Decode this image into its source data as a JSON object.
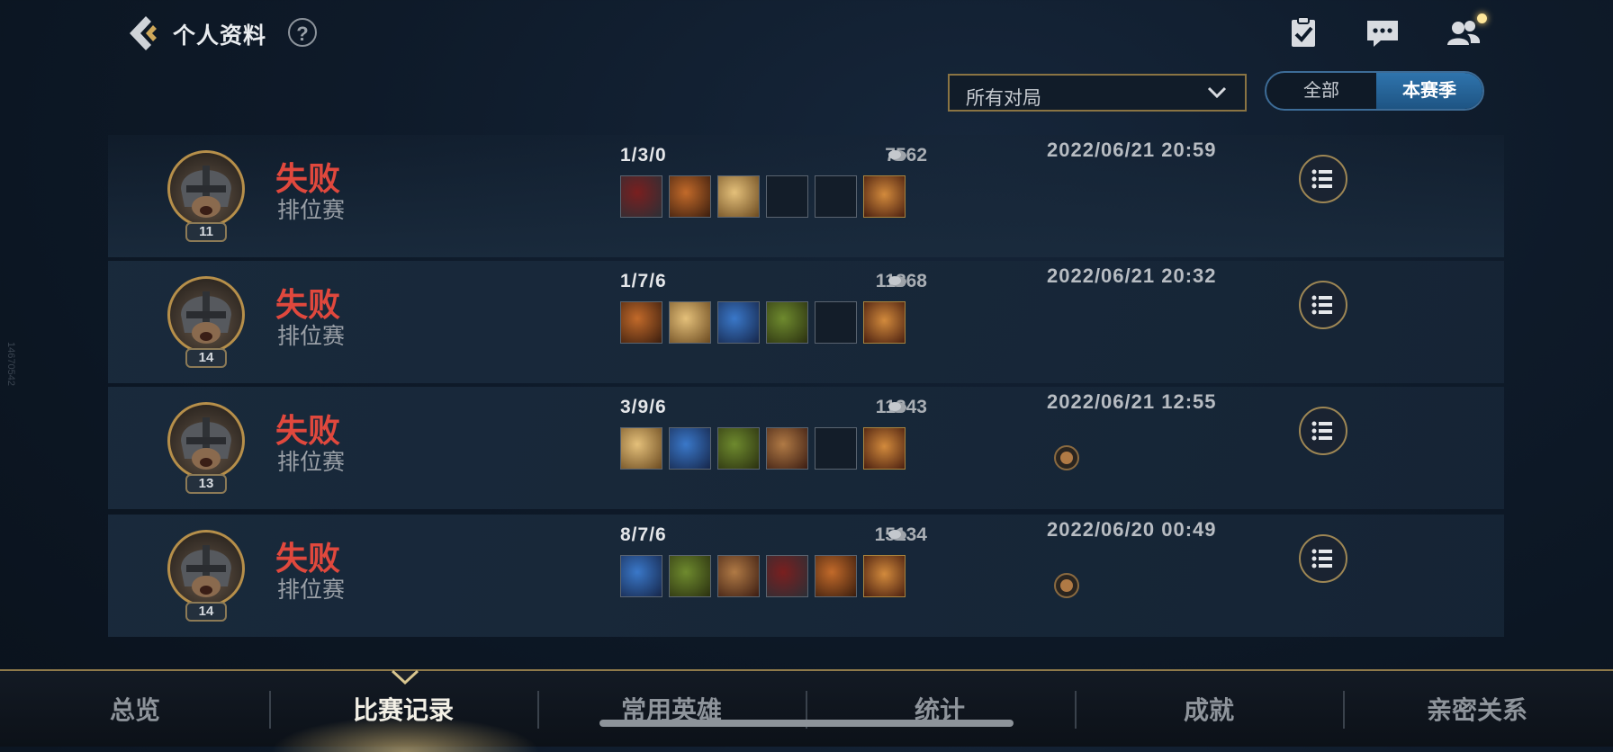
{
  "header": {
    "title": "个人资料",
    "help": "?"
  },
  "filter": {
    "selected": "所有对局",
    "season_all": "全部",
    "season_current": "本赛季"
  },
  "matches": [
    {
      "result": "失败",
      "mode": "排位赛",
      "level": "11",
      "kda": "1/3/0",
      "gold": "7562",
      "datetime": "2022/06/21 20:59",
      "items": [
        "item-icon",
        "item-icon",
        "item-icon",
        "empty",
        "empty",
        "trinket-icon"
      ],
      "badge": false
    },
    {
      "result": "失败",
      "mode": "排位赛",
      "level": "14",
      "kda": "1/7/6",
      "gold": "11868",
      "datetime": "2022/06/21 20:32",
      "items": [
        "item-icon",
        "item-icon",
        "item-icon",
        "item-icon",
        "empty",
        "trinket-icon"
      ],
      "badge": false
    },
    {
      "result": "失败",
      "mode": "排位赛",
      "level": "13",
      "kda": "3/9/6",
      "gold": "11343",
      "datetime": "2022/06/21 12:55",
      "items": [
        "item-icon",
        "item-icon",
        "item-icon",
        "item-icon",
        "empty",
        "trinket-icon"
      ],
      "badge": true
    },
    {
      "result": "失败",
      "mode": "排位赛",
      "level": "14",
      "kda": "8/7/6",
      "gold": "15134",
      "datetime": "2022/06/20 00:49",
      "items": [
        "item-icon",
        "item-icon",
        "item-icon",
        "item-icon",
        "item-icon",
        "trinket-icon"
      ],
      "badge": true
    }
  ],
  "tabs": [
    {
      "label": "总览",
      "active": false
    },
    {
      "label": "比赛记录",
      "active": true
    },
    {
      "label": "常用英雄",
      "active": false
    },
    {
      "label": "统计",
      "active": false
    },
    {
      "label": "成就",
      "active": false
    },
    {
      "label": "亲密关系",
      "active": false
    }
  ],
  "side_mark": "14670542",
  "colors": {
    "defeat": "#e0483d",
    "accent_gold": "#b68f4a",
    "season_active": "#2f74ad"
  }
}
